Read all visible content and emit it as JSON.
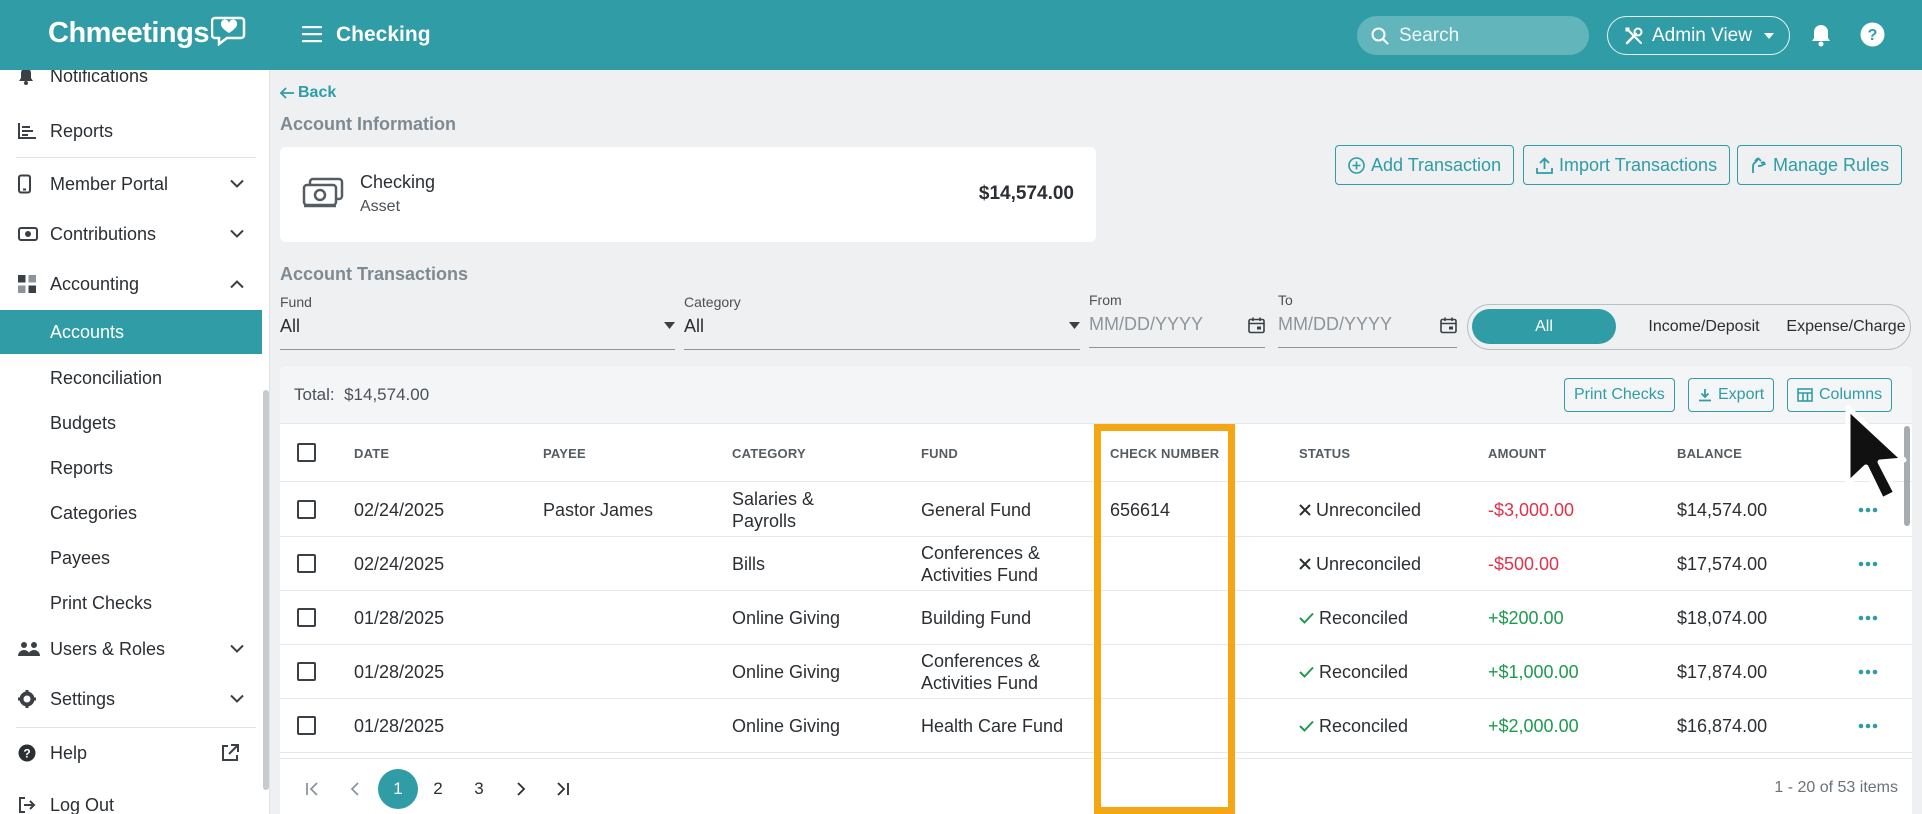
{
  "app": {
    "logo": "Chmeetings",
    "page_title": "Checking"
  },
  "header": {
    "search_placeholder": "Search",
    "admin_view": "Admin View"
  },
  "sidebar": {
    "items": {
      "notifications": "Notifications",
      "reports": "Reports",
      "member_portal": "Member Portal",
      "contributions": "Contributions",
      "accounting": "Accounting",
      "users_roles": "Users & Roles",
      "settings": "Settings",
      "help": "Help",
      "logout": "Log Out"
    },
    "accounting_sub": [
      "Accounts",
      "Reconciliation",
      "Budgets",
      "Reports",
      "Categories",
      "Payees",
      "Print Checks"
    ],
    "active_sub": "Accounts"
  },
  "main": {
    "back": "Back",
    "account_info_title": "Account Information",
    "account": {
      "name": "Checking",
      "type": "Asset",
      "balance": "$14,574.00"
    },
    "actions": {
      "add": "Add Transaction",
      "import": "Import Transactions",
      "rules": "Manage Rules"
    },
    "transactions_title": "Account Transactions",
    "filters": {
      "fund_label": "Fund",
      "fund_value": "All",
      "category_label": "Category",
      "category_value": "All",
      "from_label": "From",
      "from_placeholder": "MM/DD/YYYY",
      "to_label": "To",
      "to_placeholder": "MM/DD/YYYY"
    },
    "type_toggle": {
      "options": [
        "All",
        "Income/Deposit",
        "Expense/Charge"
      ],
      "selected": "All"
    },
    "table": {
      "total_label": "Total:",
      "total_value": "$14,574.00",
      "buttons": {
        "print_checks": "Print Checks",
        "export": "Export",
        "columns": "Columns"
      },
      "headers": [
        "DATE",
        "PAYEE",
        "CATEGORY",
        "FUND",
        "CHECK NUMBER",
        "STATUS",
        "AMOUNT",
        "BALANCE"
      ],
      "rows": [
        {
          "date": "02/24/2025",
          "payee": "Pastor James",
          "category": "Salaries & Payrolls",
          "fund": "General Fund",
          "check": "656614",
          "status": "Unreconciled",
          "amount": "-$3,000.00",
          "balance": "$14,574.00"
        },
        {
          "date": "02/24/2025",
          "payee": "",
          "category": "Bills",
          "fund": "Conferences & Activities Fund",
          "check": "",
          "status": "Unreconciled",
          "amount": "-$500.00",
          "balance": "$17,574.00"
        },
        {
          "date": "01/28/2025",
          "payee": "",
          "category": "Online Giving",
          "fund": "Building Fund",
          "check": "",
          "status": "Reconciled",
          "amount": "+$200.00",
          "balance": "$18,074.00"
        },
        {
          "date": "01/28/2025",
          "payee": "",
          "category": "Online Giving",
          "fund": "Conferences & Activities Fund",
          "check": "",
          "status": "Reconciled",
          "amount": "+$1,000.00",
          "balance": "$17,874.00"
        },
        {
          "date": "01/28/2025",
          "payee": "",
          "category": "Online Giving",
          "fund": "Health Care Fund",
          "check": "",
          "status": "Reconciled",
          "amount": "+$2,000.00",
          "balance": "$16,874.00"
        }
      ]
    },
    "pagination": {
      "pages": [
        "1",
        "2",
        "3"
      ],
      "current": "1",
      "info": "1 - 20 of 53 items"
    }
  },
  "colors": {
    "brand": "#2f9ca6",
    "highlight": "#f4a615",
    "negative": "#e0324b",
    "positive": "#1e9a4f"
  }
}
